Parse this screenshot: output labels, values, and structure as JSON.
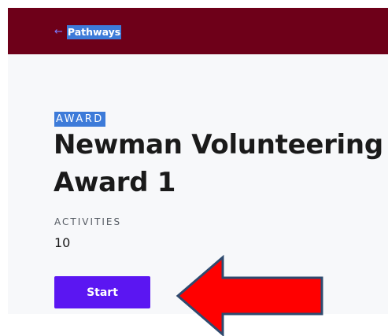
{
  "header": {
    "back_icon": "arrow-left-icon",
    "back_label": "Pathways"
  },
  "award": {
    "tag": "AWARD",
    "title_line1": "Newman Volunteering",
    "title_line2": "Award 1",
    "activities_label": "ACTIVITIES",
    "activities_value": "10"
  },
  "actions": {
    "start_label": "Start"
  },
  "annotation": {
    "icon": "red-arrow-pointer-icon"
  },
  "colors": {
    "header_bg": "#6e0019",
    "content_bg": "#f7f8fa",
    "selection_highlight": "#3d7bd9",
    "button_bg": "#5b16f2",
    "annotation_fill": "#ff0000",
    "annotation_stroke": "#2f4a6e"
  }
}
